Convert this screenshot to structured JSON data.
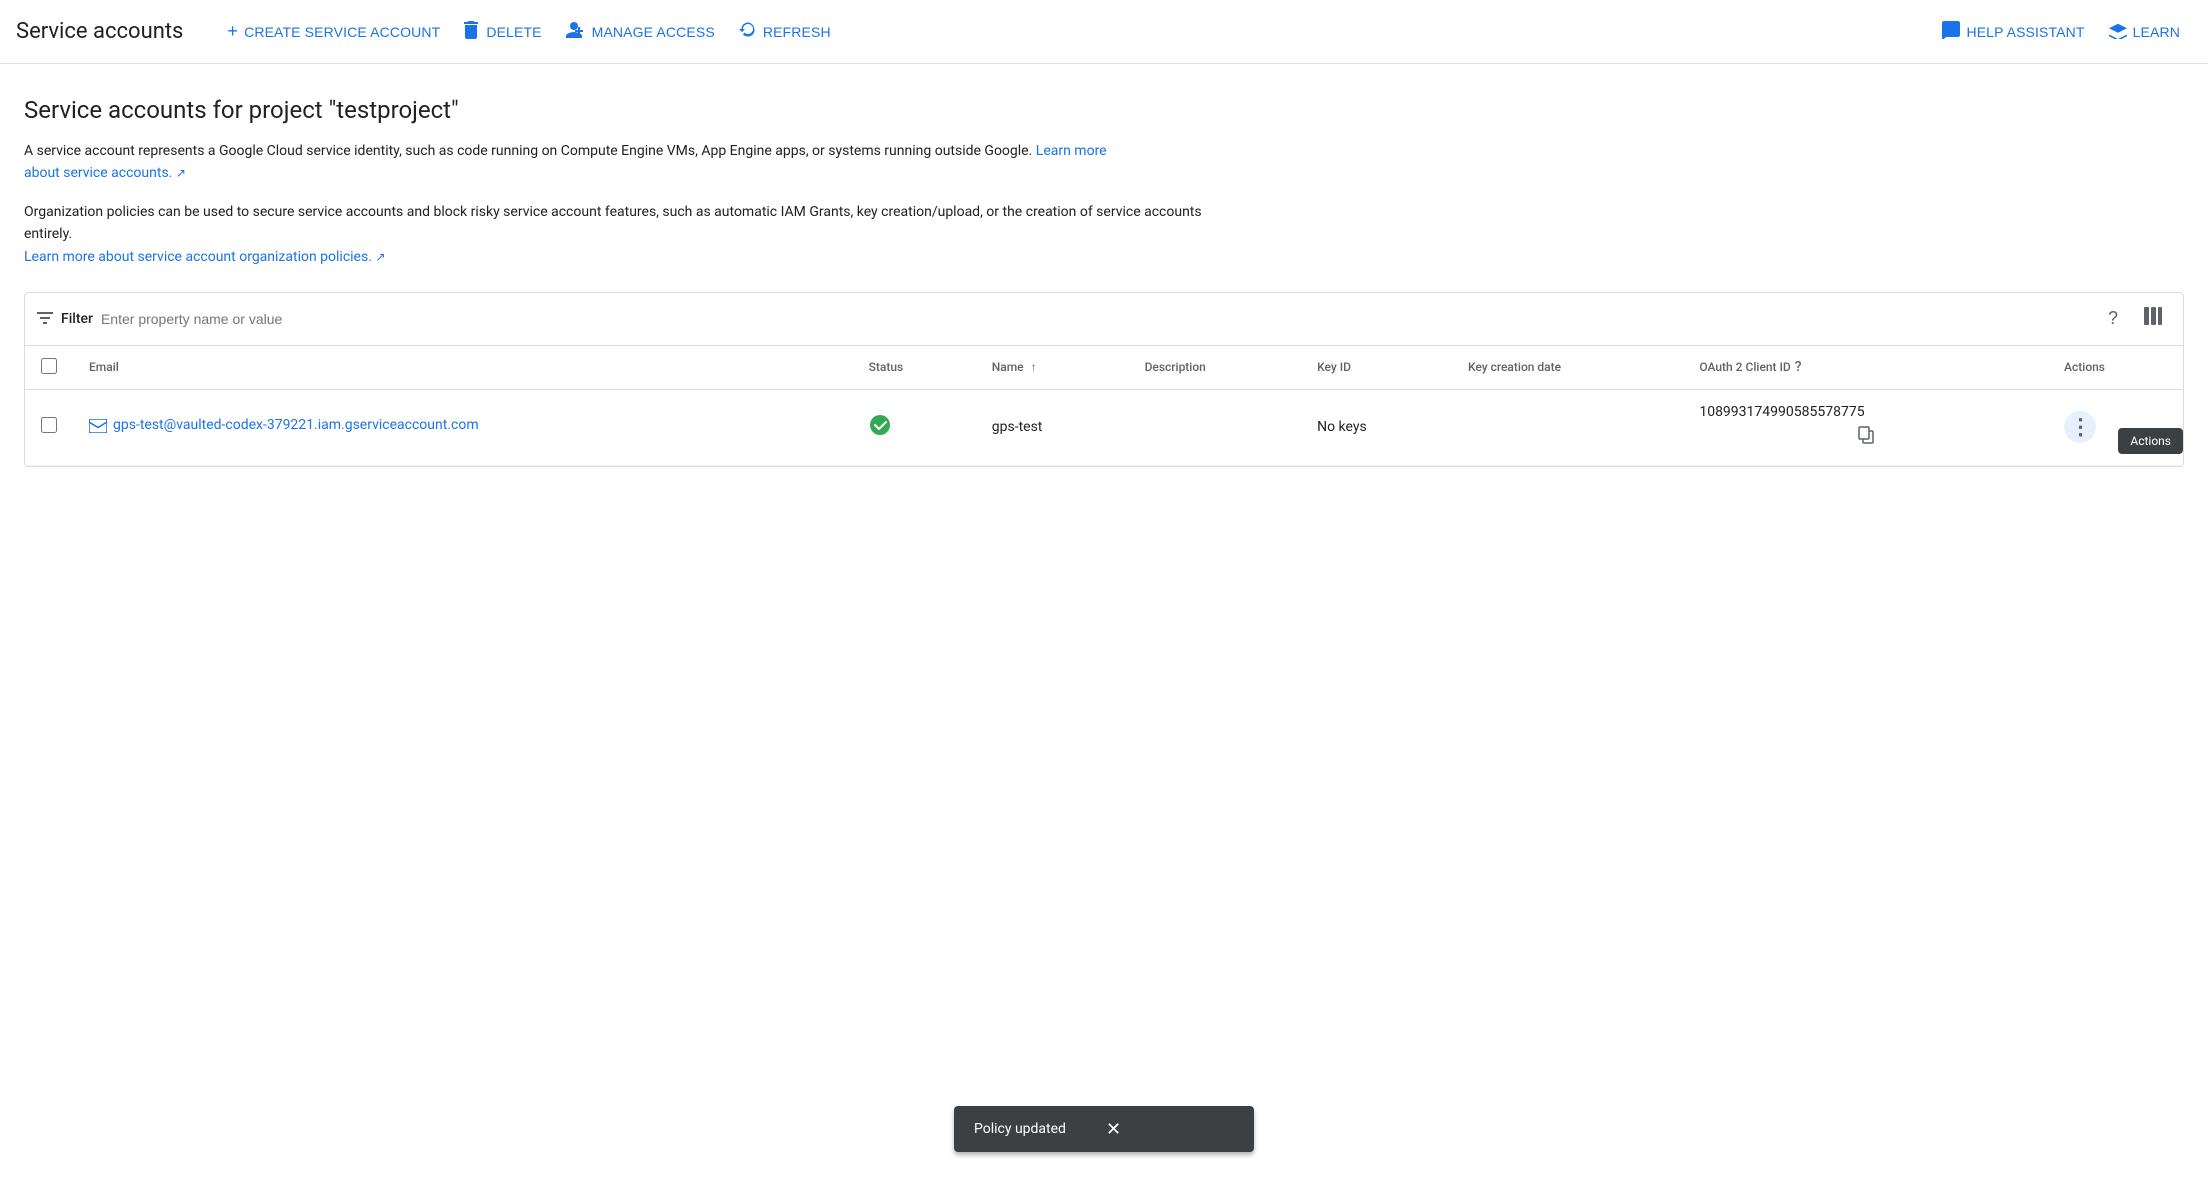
{
  "toolbar": {
    "title": "Service accounts",
    "buttons": [
      {
        "id": "create",
        "label": "CREATE SERVICE ACCOUNT",
        "icon": "+"
      },
      {
        "id": "delete",
        "label": "DELETE",
        "icon": "🗑"
      },
      {
        "id": "manage",
        "label": "MANAGE ACCESS",
        "icon": "👤+"
      },
      {
        "id": "refresh",
        "label": "REFRESH",
        "icon": "↻"
      },
      {
        "id": "help",
        "label": "HELP ASSISTANT",
        "icon": "💬"
      },
      {
        "id": "learn",
        "label": "LEARN",
        "icon": "🎓"
      }
    ]
  },
  "page": {
    "title": "Service accounts for project \"testproject\"",
    "description": "A service account represents a Google Cloud service identity, such as code running on Compute Engine VMs, App Engine apps, or systems running outside Google.",
    "description_link": "Learn more about service accounts.",
    "org_policy_text": "Organization policies can be used to secure service accounts and block risky service account features, such as automatic IAM Grants, key creation/upload, or the creation of service accounts entirely.",
    "org_policy_link": "Learn more about service account organization policies."
  },
  "filter": {
    "label": "Filter",
    "placeholder": "Enter property name or value"
  },
  "table": {
    "columns": [
      {
        "id": "email",
        "label": "Email"
      },
      {
        "id": "status",
        "label": "Status"
      },
      {
        "id": "name",
        "label": "Name",
        "sortable": true
      },
      {
        "id": "description",
        "label": "Description"
      },
      {
        "id": "key_id",
        "label": "Key ID"
      },
      {
        "id": "key_creation_date",
        "label": "Key creation date"
      },
      {
        "id": "oauth_client_id",
        "label": "OAuth 2 Client ID",
        "has_help": true
      },
      {
        "id": "actions",
        "label": "Actions"
      }
    ],
    "rows": [
      {
        "email": "gps-test@vaulted-codex-379221.iam.gserviceaccount.com",
        "status": "active",
        "name": "gps-test",
        "description": "",
        "key_id": "No keys",
        "key_creation_date": "",
        "oauth_client_id": "108993174990585578775"
      }
    ]
  },
  "tooltip": {
    "actions_label": "Actions"
  },
  "snackbar": {
    "message": "Policy updated",
    "close_label": "✕"
  },
  "icons": {
    "filter": "☰",
    "question": "?",
    "columns": "▦",
    "copy": "⧉",
    "more_vert": "⋮",
    "check": "✓",
    "external_link": "↗"
  }
}
